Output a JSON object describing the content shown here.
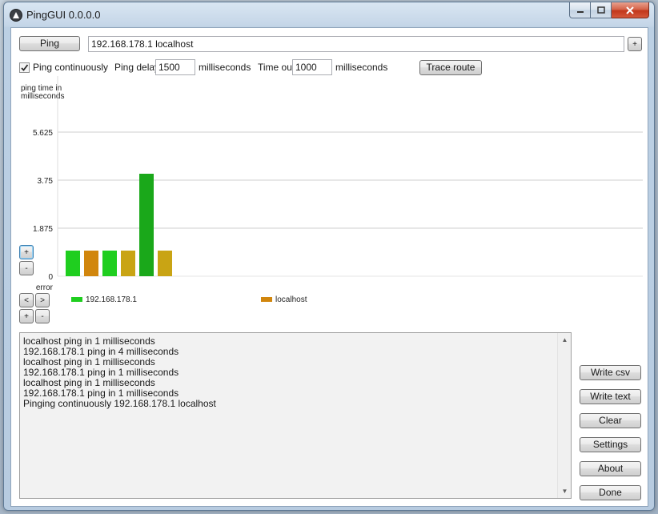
{
  "window": {
    "title": "PingGUI 0.0.0.0"
  },
  "toolbar": {
    "ping_label": "Ping",
    "hosts_value": "192.168.178.1 localhost",
    "hosts_menu_label": "+",
    "ping_continuously_label": "Ping continuously",
    "ping_continuously_checked": true,
    "ping_delay_label": "Ping delay",
    "ping_delay_value": "1500",
    "ping_delay_unit": "milliseconds",
    "timeout_label": "Time out",
    "timeout_value": "1000",
    "timeout_unit": "milliseconds",
    "trace_route_label": "Trace route"
  },
  "chart_controls": {
    "zoom_in_label": "+",
    "zoom_out_label": "-",
    "scroll_left_label": "<",
    "scroll_right_label": ">",
    "add_label": "+",
    "remove_label": "-"
  },
  "chart_data": {
    "type": "bar",
    "ylabel": "ping time in milliseconds",
    "ylim": [
      0,
      7.5
    ],
    "yticks": [
      {
        "value": 0,
        "label": "0"
      },
      {
        "value": 1.875,
        "label": "1.875"
      },
      {
        "value": 3.75,
        "label": "3.75"
      },
      {
        "value": 5.625,
        "label": "5.625"
      }
    ],
    "error_label": "error",
    "grid": true,
    "legend_position": "bottom",
    "series": [
      {
        "name": "192.168.178.1",
        "color": "#1fce1f"
      },
      {
        "name": "localhost",
        "color": "#d1860d"
      }
    ],
    "bars": [
      {
        "series": 0,
        "value": 1,
        "color": "#1fce1f"
      },
      {
        "series": 1,
        "value": 1,
        "color": "#d1860d"
      },
      {
        "series": 0,
        "value": 1,
        "color": "#1fce1f"
      },
      {
        "series": 1,
        "value": 1,
        "color": "#c9a414"
      },
      {
        "series": 0,
        "value": 4,
        "color": "#1aa81a"
      },
      {
        "series": 1,
        "value": 1,
        "color": "#c9a414"
      }
    ]
  },
  "log": {
    "lines": [
      "localhost ping in 1 milliseconds",
      "192.168.178.1 ping in 4 milliseconds",
      "localhost ping in 1 milliseconds",
      "192.168.178.1 ping in 1 milliseconds",
      "localhost ping in 1 milliseconds",
      "192.168.178.1 ping in 1 milliseconds",
      "Pinging continuously 192.168.178.1 localhost"
    ],
    "scroll_up": "▲",
    "scroll_down": "▼"
  },
  "side_buttons": {
    "write_csv": "Write csv",
    "write_text": "Write text",
    "clear": "Clear",
    "settings": "Settings",
    "about": "About",
    "done": "Done"
  }
}
